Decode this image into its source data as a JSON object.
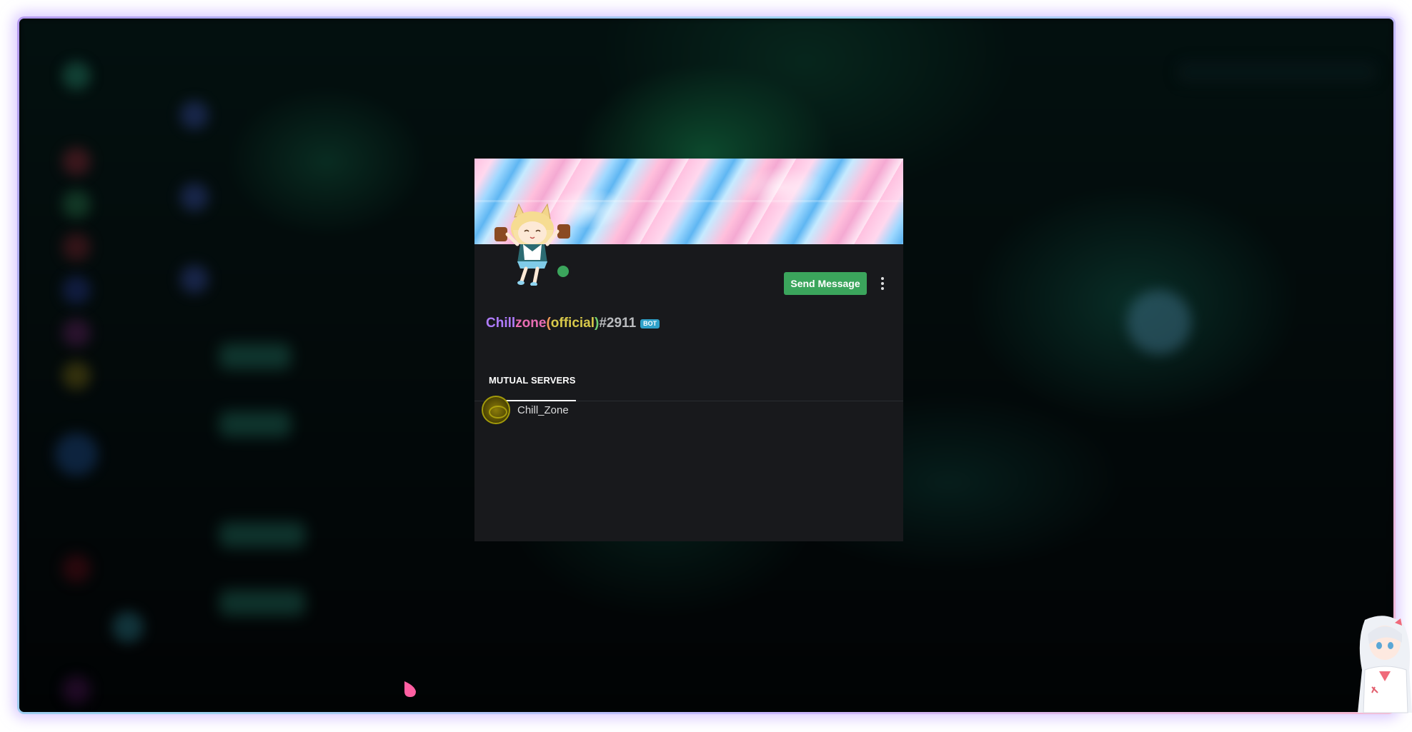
{
  "profile": {
    "name_segments": [
      {
        "text": "Chill",
        "color": "#b07cff"
      },
      {
        "text": "zone",
        "color": "#e86db3"
      },
      {
        "text": "(",
        "color": "#f29b5a"
      },
      {
        "text": "official",
        "color": "#d8c94a"
      },
      {
        "text": ")",
        "color": "#6fcf72"
      }
    ],
    "discriminator": "#2911",
    "bot_tag": "BOT",
    "status": "online",
    "status_color": "#3ba55c",
    "avatar_icon": "chibi-catgirl-avatar"
  },
  "actions": {
    "send_message_label": "Send Message",
    "more_icon": "vertical-ellipsis-icon"
  },
  "tabs": [
    {
      "label": "MUTUAL SERVERS",
      "active": true
    }
  ],
  "mutual_servers": [
    {
      "name": "Chill_Zone",
      "icon": "chill-zone-server-icon"
    }
  ],
  "colors": {
    "accent_green": "#3ba55c",
    "modal_bg": "#18191c",
    "bot_tag_bg": "#2fa1c9"
  }
}
